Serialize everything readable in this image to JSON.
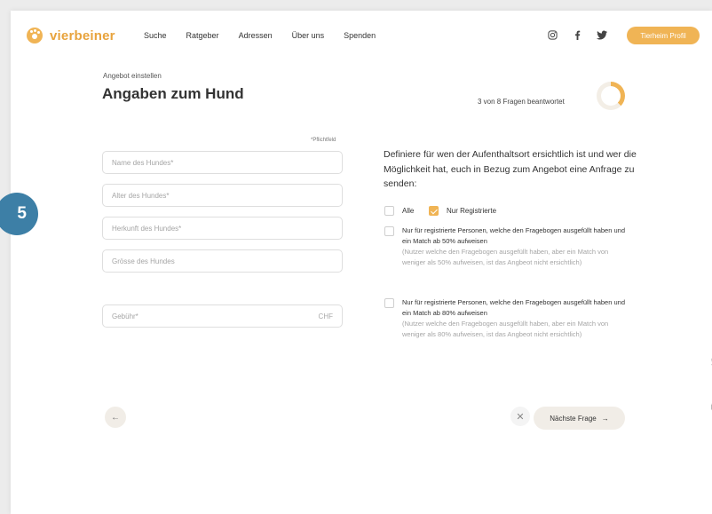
{
  "brand": {
    "name": "vierbeiner",
    "accent": "#f0b455",
    "step_badge_color": "#3d7fa6"
  },
  "nav": {
    "items": [
      "Suche",
      "Ratgeber",
      "Adressen",
      "Über uns",
      "Spenden"
    ]
  },
  "social": {
    "icons": [
      "instagram-icon",
      "facebook-icon",
      "twitter-icon"
    ]
  },
  "profile_button": "Tierheim Profil",
  "heading": {
    "eyebrow": "Angebot einstellen",
    "title": "Angaben zum Hund"
  },
  "progress": {
    "text": "3 von 8 Fragen beantwortet",
    "answered": 3,
    "total": 8
  },
  "form": {
    "required_note": "*Pflichtfeld",
    "fields": [
      {
        "placeholder": "Name des Hundes*"
      },
      {
        "placeholder": "Alter des Hundes*"
      },
      {
        "placeholder": "Herkunft des Hundes*"
      },
      {
        "placeholder": "Grösse des Hundes"
      },
      {
        "placeholder": "Gebühr*",
        "unit": "CHF"
      }
    ]
  },
  "visibility": {
    "question": "Definiere für wen der Aufenthaltsort ersichtlich ist und wer die Möglichkeit hat, euch in Bezug zum Angebot eine Anfrage zu senden:",
    "all_label": "Alle",
    "all_checked": false,
    "registered_label": "Nur Registrierte",
    "registered_checked": true,
    "options": [
      {
        "main": "Nur für registrierte Personen, welche den Fragebogen ausgefüllt haben und ein Match ab 50% aufweisen",
        "sub": "(Nutzer welche den Fragebogen ausgefüllt haben, aber ein Match von weniger als 50% aufweisen, ist das Angbeot nicht ersichtlich)",
        "checked": false
      },
      {
        "main": "Nur für registrierte Personen, welche den Fragebogen ausgefüllt haben und ein Match ab 80% aufweisen",
        "sub": "(Nutzer welche den Fragebogen ausgefüllt haben, aber ein Match von weniger als 80% aufweisen, ist das Angbeot nicht ersichtlich)",
        "checked": false
      }
    ]
  },
  "footer": {
    "back_icon": "←",
    "close_icon": "✕",
    "next_label": "Nächste Frage",
    "next_icon": "→"
  },
  "step": "5",
  "side_share": {
    "icons": [
      "twitter-icon",
      "message-icon",
      "mail-icon"
    ]
  }
}
